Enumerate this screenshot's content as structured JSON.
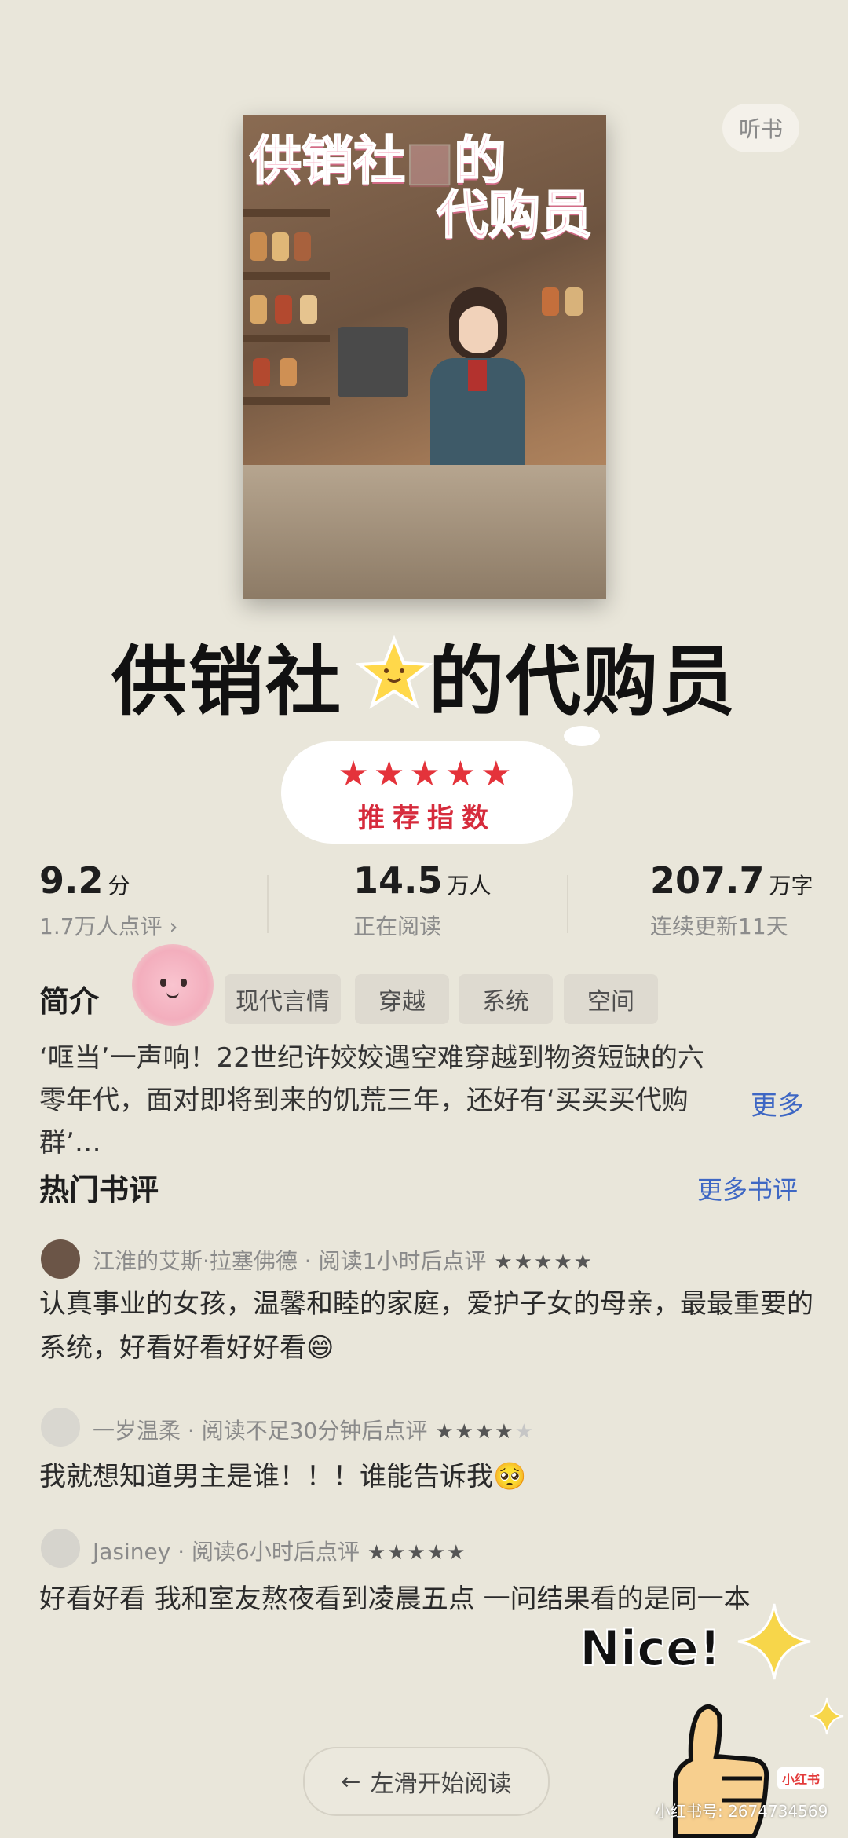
{
  "header": {
    "listen_label": "听书"
  },
  "cover": {
    "title_line1": "供销社",
    "title_line2_a": "的",
    "title_line3": "代购员"
  },
  "book": {
    "title_part1": "供销社",
    "title_part2": "的代购员",
    "recommend_stars": "★★★★★",
    "recommend_label": "推荐指数"
  },
  "stats": {
    "rating": {
      "value": "9.2",
      "unit": "分",
      "sub": "1.7万人点评 ›"
    },
    "reading": {
      "value": "14.5",
      "unit": "万人",
      "sub": "正在阅读"
    },
    "words": {
      "value": "207.7",
      "unit": "万字",
      "sub": "连续更新11天"
    }
  },
  "intro": {
    "title": "简介",
    "tags": [
      "现代言情",
      "穿越",
      "系统",
      "空间"
    ],
    "synopsis": "‘哐当’一声响！22世纪许姣姣遇空难穿越到物资短缺的六零年代，面对即将到来的饥荒三年，还好有‘买买买代购群’…",
    "more_label": "更多"
  },
  "reviews": {
    "title": "热门书评",
    "more_label": "更多书评",
    "items": [
      {
        "meta": "江淮的艾斯·拉塞佛德 · 阅读1小时后点评",
        "stars_on": "★★★★★",
        "stars_off": "",
        "text": "认真事业的女孩，温馨和睦的家庭，爱护子女的母亲，最最重要的系统，好看好看好好看😄",
        "avatar_color": "#6b5547"
      },
      {
        "meta": "一岁温柔 · 阅读不足30分钟后点评",
        "stars_on": "★★★★",
        "stars_off": "★",
        "text": "我就想知道男主是谁！！！谁能告诉我🥺",
        "avatar_color": "#d9d7d0"
      },
      {
        "meta": "Jasiney · 阅读6小时后点评",
        "stars_on": "★★★★★",
        "stars_off": "",
        "text": "好看好看 我和室友熬夜看到凌晨五点 一问结果看的是同一本",
        "avatar_color": "#d6d4cd"
      }
    ]
  },
  "footer": {
    "start_reading_label": "左滑开始阅读",
    "nice_label": "Nice!",
    "watermark": "小红书号: 2674734569",
    "logo_text": "小红书"
  }
}
